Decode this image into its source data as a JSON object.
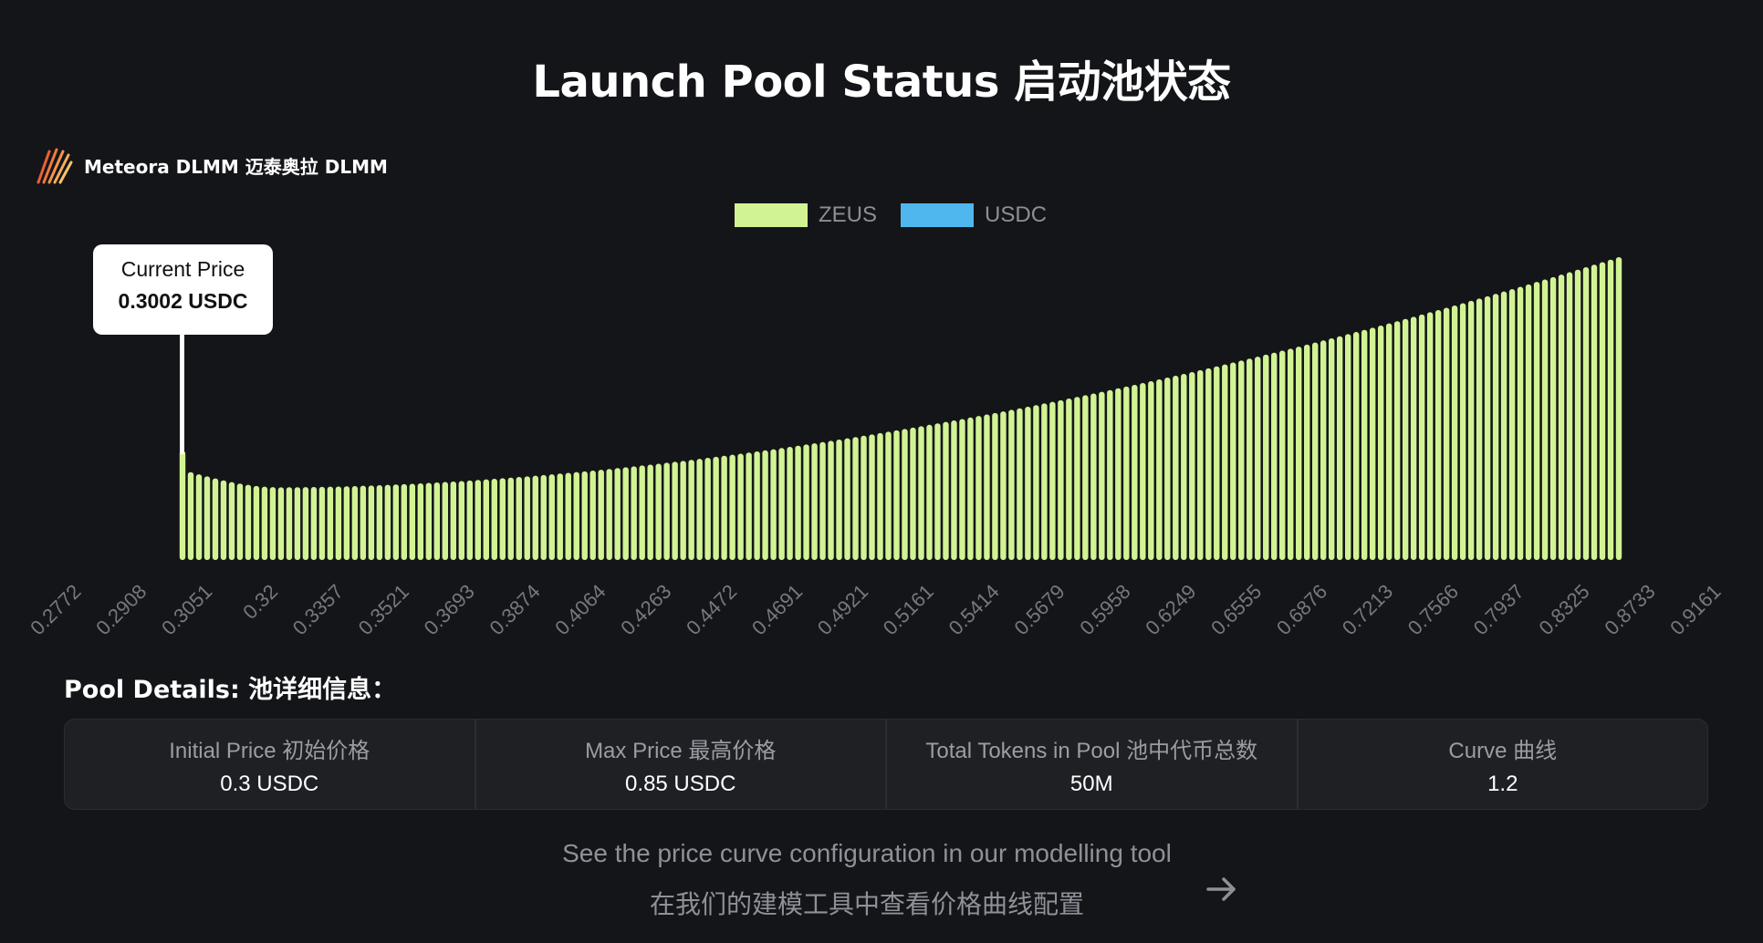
{
  "page": {
    "title": "Launch Pool Status 启动池状态"
  },
  "brand": {
    "name": "Meteora DLMM 迈泰奥拉 DLMM",
    "icon": "meteora-logo-icon"
  },
  "colors": {
    "zeus": "#d2f394",
    "usdc": "#4fb7ee",
    "background": "#141519"
  },
  "tooltip": {
    "label": "Current Price",
    "value": "0.3002 USDC"
  },
  "chart_data": {
    "type": "bar",
    "series": [
      {
        "name": "ZEUS",
        "color": "#d2f394"
      },
      {
        "name": "USDC",
        "color": "#4fb7ee"
      }
    ],
    "x_tick_labels": [
      "0.2772",
      "0.2908",
      "0.3051",
      "0.32",
      "0.3357",
      "0.3521",
      "0.3693",
      "0.3874",
      "0.4064",
      "0.4263",
      "0.4472",
      "0.4691",
      "0.4921",
      "0.5161",
      "0.5414",
      "0.5679",
      "0.5958",
      "0.6249",
      "0.6555",
      "0.6876",
      "0.7213",
      "0.7566",
      "0.7937",
      "0.8325",
      "0.8733",
      "0.9161"
    ],
    "price_range": [
      0.3,
      0.85
    ],
    "current_price": 0.3002,
    "bar_count": 176,
    "zeus_liquidity_shape": {
      "first_bar_relative": 0.36,
      "second_bar_relative": 0.29,
      "min_relative": 0.24,
      "min_at_bar_fraction": 0.07,
      "last_bar_relative": 1.0,
      "curve_exponent": 1.2
    },
    "legend": "top-center",
    "grid": false
  },
  "details": {
    "title": "Pool Details: 池详细信息：",
    "items": [
      {
        "label": "Initial Price 初始价格",
        "value": "0.3 USDC"
      },
      {
        "label": "Max Price 最高价格",
        "value": "0.85 USDC"
      },
      {
        "label": "Total Tokens in Pool 池中代币总数",
        "value": "50M"
      },
      {
        "label": "Curve 曲线",
        "value": "1.2"
      }
    ]
  },
  "footer": {
    "line1": "See the price curve configuration in our modelling tool",
    "line2": "在我们的建模工具中查看价格曲线配置",
    "icon": "arrow-right-icon"
  }
}
